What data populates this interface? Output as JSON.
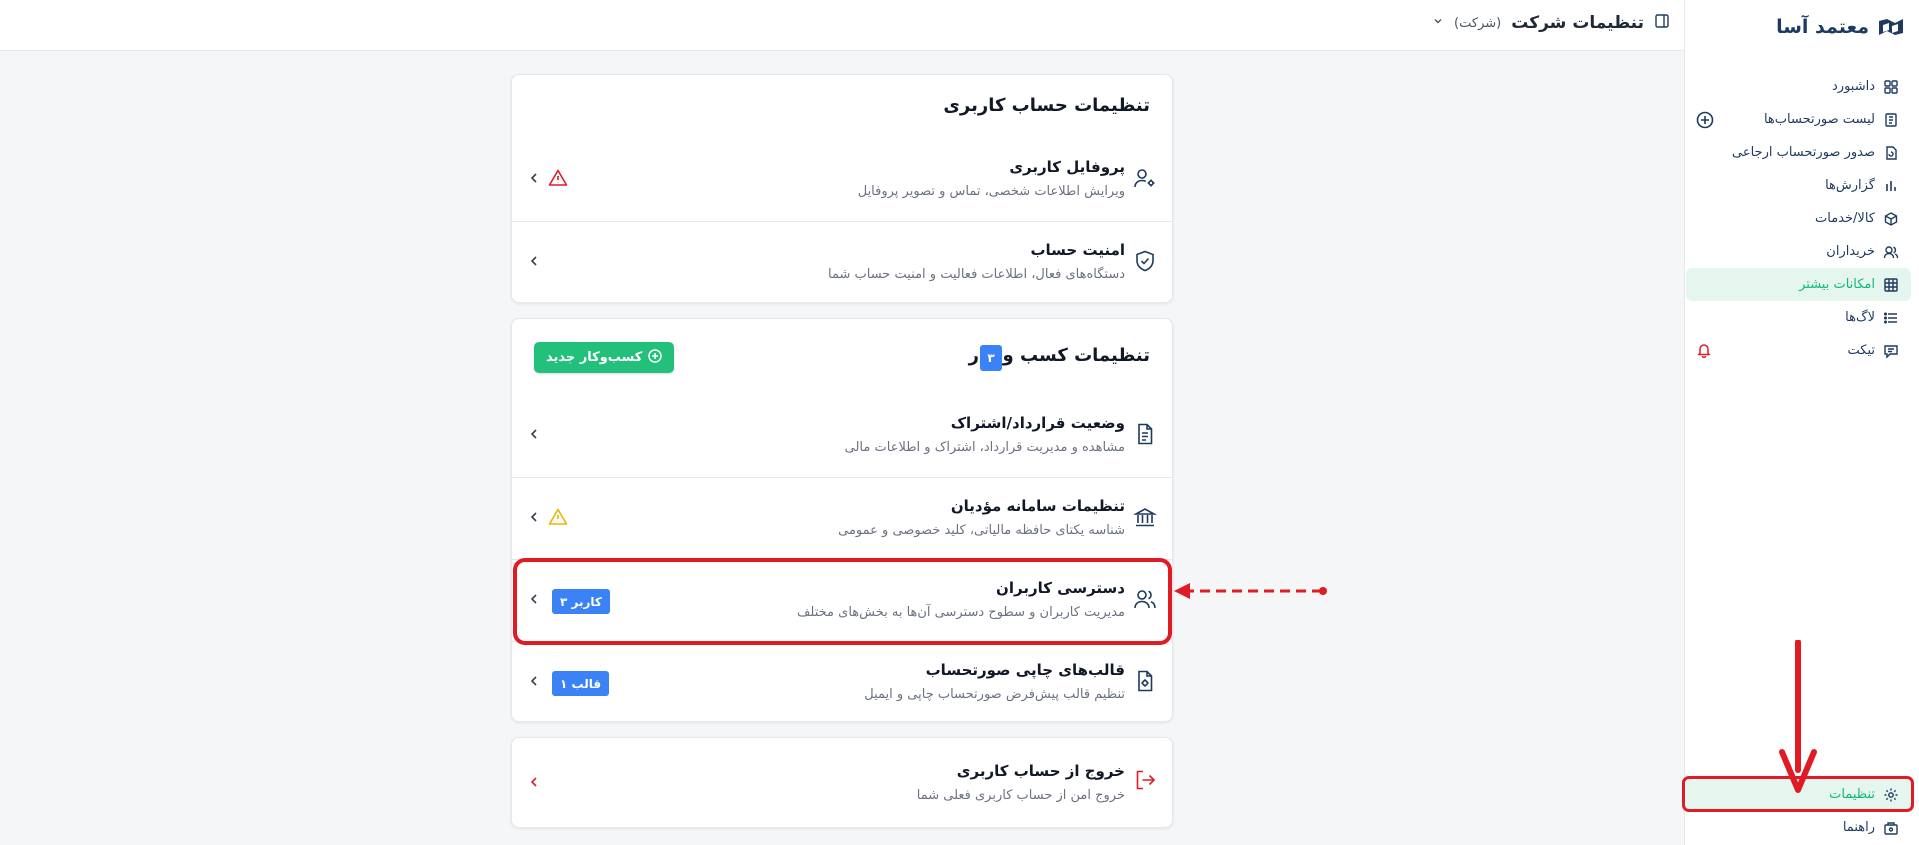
{
  "app": {
    "brand": "معتمد آسا"
  },
  "topbar": {
    "title": "تنظیمات شرکت",
    "subtitle": "(شرکت)"
  },
  "sidebar": {
    "items": [
      {
        "label": "داشبورد",
        "icon": "dashboard-icon"
      },
      {
        "label": "لیست صورتحساب‌ها",
        "icon": "list-invoice-icon"
      },
      {
        "label": "صدور صورتحساب ارجاعی",
        "icon": "refund-invoice-icon"
      },
      {
        "label": "گزارش‌ها",
        "icon": "chart-icon"
      },
      {
        "label": "کالا/خدمات",
        "icon": "box-icon"
      },
      {
        "label": "خریداران",
        "icon": "users-icon"
      },
      {
        "label": "امکانات بیشتر",
        "icon": "grid-icon"
      },
      {
        "label": "لاگ‌ها",
        "icon": "list-icon"
      },
      {
        "label": "تیکت",
        "icon": "ticket-icon"
      }
    ],
    "bottom": [
      {
        "label": "تنظیمات",
        "icon": "gear-icon"
      },
      {
        "label": "راهنما",
        "icon": "help-icon"
      }
    ]
  },
  "account_card": {
    "title": "تنظیمات حساب کاربری",
    "rows": [
      {
        "title": "پروفایل کاربری",
        "desc": "ویرایش اطلاعات شخصی، تماس و تصویر پروفایل"
      },
      {
        "title": "امنیت حساب",
        "desc": "دستگاه‌های فعال، اطلاعات فعالیت و امنیت حساب شما"
      }
    ]
  },
  "business_card": {
    "title": "تنظیمات کسب و کار",
    "count": "۳",
    "new_button": "کسب‌وکار جدید",
    "rows": [
      {
        "title": "وضعیت قرارداد/اشتراک",
        "desc": "مشاهده و مدیریت قرارداد، اشتراک و اطلاعات مالی"
      },
      {
        "title": "تنظیمات سامانه مؤدیان",
        "desc": "شناسه یکتای حافظه مالیاتی، کلید خصوصی و عمومی"
      },
      {
        "title": "دسترسی کاربران",
        "desc": "مدیریت کاربران و سطوح دسترسی آن‌ها به بخش‌های مختلف",
        "badge": "۳ کاربر"
      },
      {
        "title": "قالب‌های چاپی صورتحساب",
        "desc": "تنظیم قالب پیش‌فرض صورتحساب چاپی و ایمیل",
        "badge": "۱ قالب"
      }
    ]
  },
  "logout_card": {
    "title": "خروج از حساب کاربری",
    "desc": "خروج امن از حساب کاربری فعلی شما"
  },
  "colors": {
    "accent": "#22c07a",
    "primary": "#1e3a5f",
    "badge": "#3b82f6",
    "danger": "#e01b24",
    "warning": "#eab308"
  }
}
